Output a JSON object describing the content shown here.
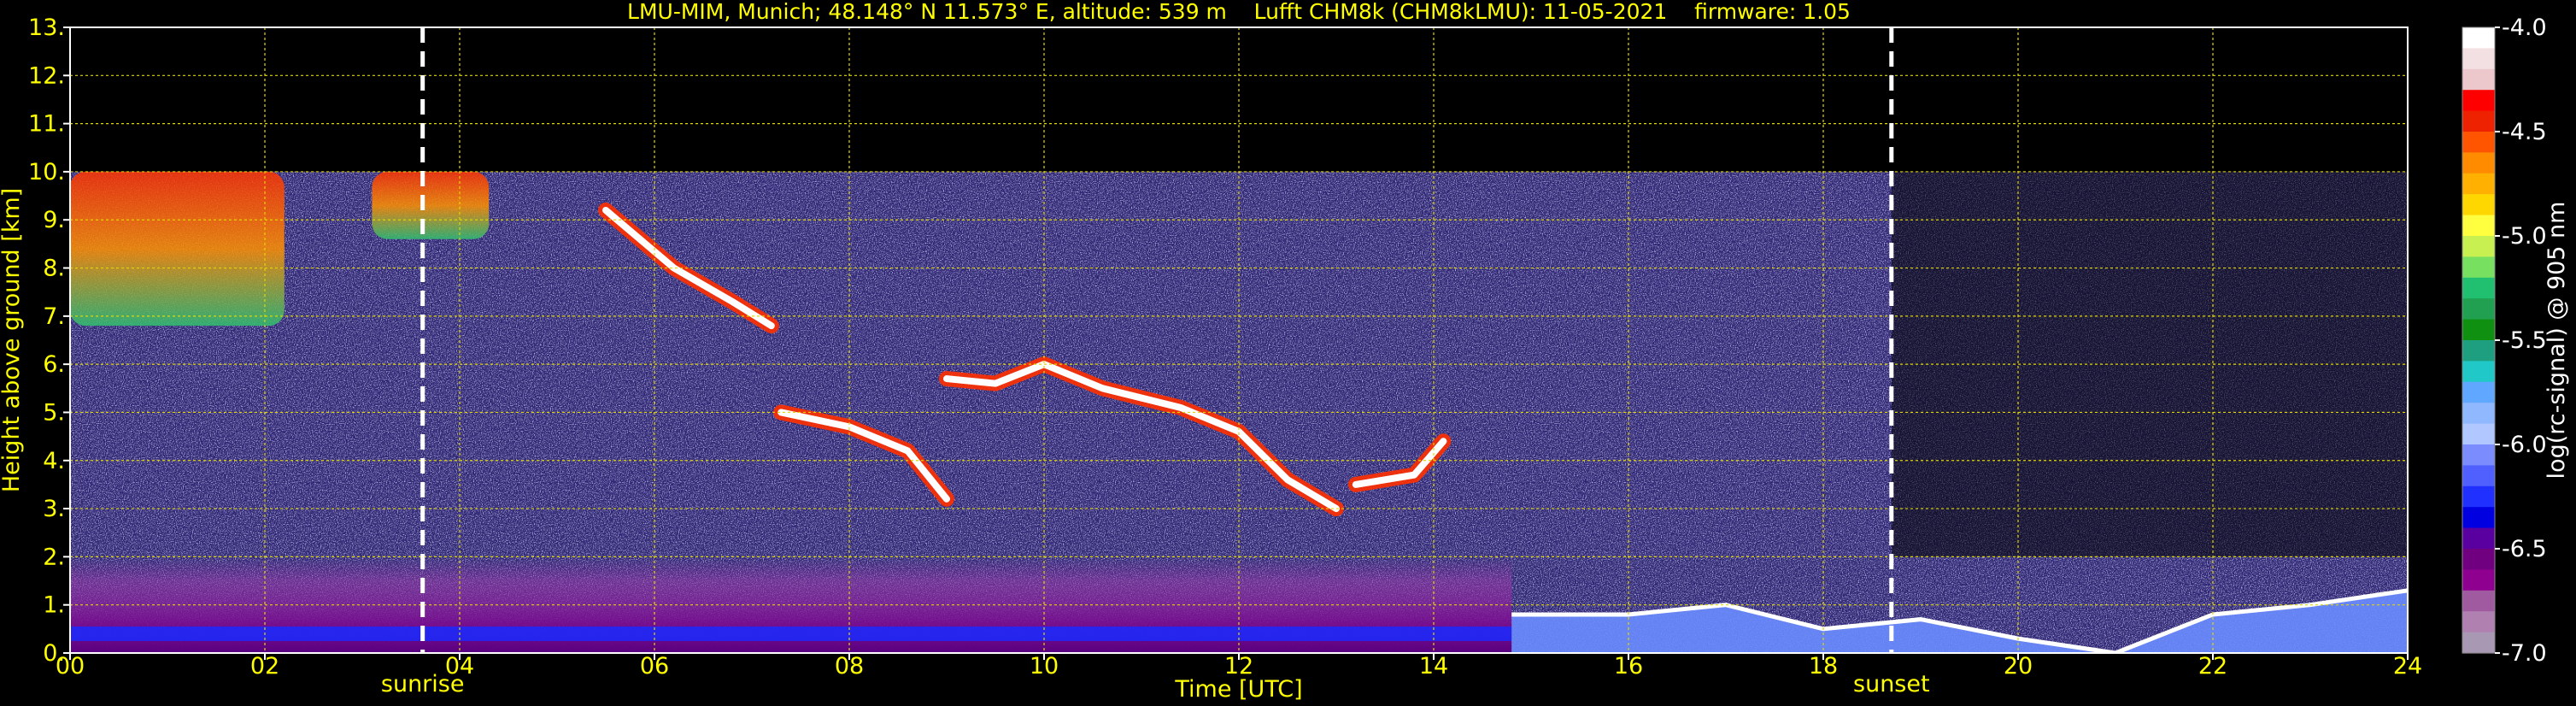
{
  "chart_data": {
    "type": "heatmap",
    "title": "LMU-MIM, Munich; 48.148° N 11.573° E, altitude: 539 m    Lufft CHM8k (CHM8kLMU): 11-05-2021    firmware: 1.05",
    "xlabel": "Time [UTC]",
    "ylabel": "Height above ground [km]",
    "colorbar_label": "log(rc-signal) @ 905 nm",
    "xlim": [
      0,
      24
    ],
    "ylim": [
      0,
      13
    ],
    "x_ticks": [
      "00",
      "02",
      "04",
      "06",
      "08",
      "10",
      "12",
      "14",
      "16",
      "18",
      "20",
      "22",
      "24"
    ],
    "y_ticks": [
      "0.",
      "1.",
      "2.",
      "3.",
      "4.",
      "5.",
      "6.",
      "7.",
      "8.",
      "9.",
      "10.",
      "11.",
      "12.",
      "13."
    ],
    "colorbar_range": [
      -7.0,
      -4.0
    ],
    "colorbar_ticks": [
      "-4.0",
      "-4.5",
      "-5.0",
      "-5.5",
      "-6.0",
      "-6.5",
      "-7.0"
    ],
    "colorbar_colors": [
      "#ffffff",
      "#f2e0e3",
      "#ecc8cd",
      "#ff0000",
      "#ee2200",
      "#ff5500",
      "#ff8c00",
      "#ffb000",
      "#ffd700",
      "#ffff40",
      "#c8f050",
      "#78e060",
      "#20c070",
      "#20a050",
      "#109010",
      "#1ea080",
      "#20c8c8",
      "#60a8ff",
      "#90b8ff",
      "#b0c8ff",
      "#7b8cff",
      "#5060ff",
      "#2030ff",
      "#0000e0",
      "#5a00a0",
      "#700080",
      "#900090",
      "#a05aa0",
      "#b080b0",
      "#a898b4"
    ],
    "grid": true,
    "vertical_markers": [
      {
        "label": "sunrise",
        "x": 3.62
      },
      {
        "label": "sunset",
        "x": 18.7
      }
    ],
    "max_signal_height": 10,
    "features": [
      {
        "type": "cirrus",
        "t_start": 0.0,
        "t_end": 2.2,
        "h_bottom": 6.8,
        "h_top": 10.0
      },
      {
        "type": "cirrus",
        "t_start": 3.1,
        "t_end": 4.3,
        "h_bottom": 8.6,
        "h_top": 10.0
      },
      {
        "type": "descending_cloud_layer",
        "points": [
          [
            5.5,
            9.2
          ],
          [
            6.2,
            8.0
          ],
          [
            6.8,
            7.3
          ],
          [
            7.2,
            6.8
          ]
        ]
      },
      {
        "type": "descending_cloud_layer",
        "points": [
          [
            7.3,
            5.0
          ],
          [
            8.0,
            4.7
          ],
          [
            8.6,
            4.2
          ],
          [
            9.0,
            3.2
          ]
        ]
      },
      {
        "type": "cloud_layer",
        "points": [
          [
            9.0,
            5.7
          ],
          [
            9.5,
            5.6
          ],
          [
            10.0,
            6.0
          ],
          [
            10.6,
            5.5
          ],
          [
            11.4,
            5.1
          ],
          [
            12.0,
            4.6
          ],
          [
            12.5,
            3.6
          ],
          [
            13.0,
            3.0
          ]
        ]
      },
      {
        "type": "low_cloud",
        "points": [
          [
            13.2,
            3.5
          ],
          [
            13.8,
            3.7
          ],
          [
            14.1,
            4.4
          ]
        ]
      },
      {
        "type": "boundary_layer_top",
        "points": [
          [
            14.8,
            0.8
          ],
          [
            16.0,
            0.8
          ],
          [
            17.0,
            1.0
          ],
          [
            18.0,
            0.5
          ],
          [
            19.0,
            0.7
          ],
          [
            20.0,
            0.3
          ],
          [
            21.0,
            0.0
          ],
          [
            22.0,
            0.8
          ],
          [
            23.0,
            1.0
          ],
          [
            24.0,
            1.3
          ]
        ]
      }
    ]
  }
}
